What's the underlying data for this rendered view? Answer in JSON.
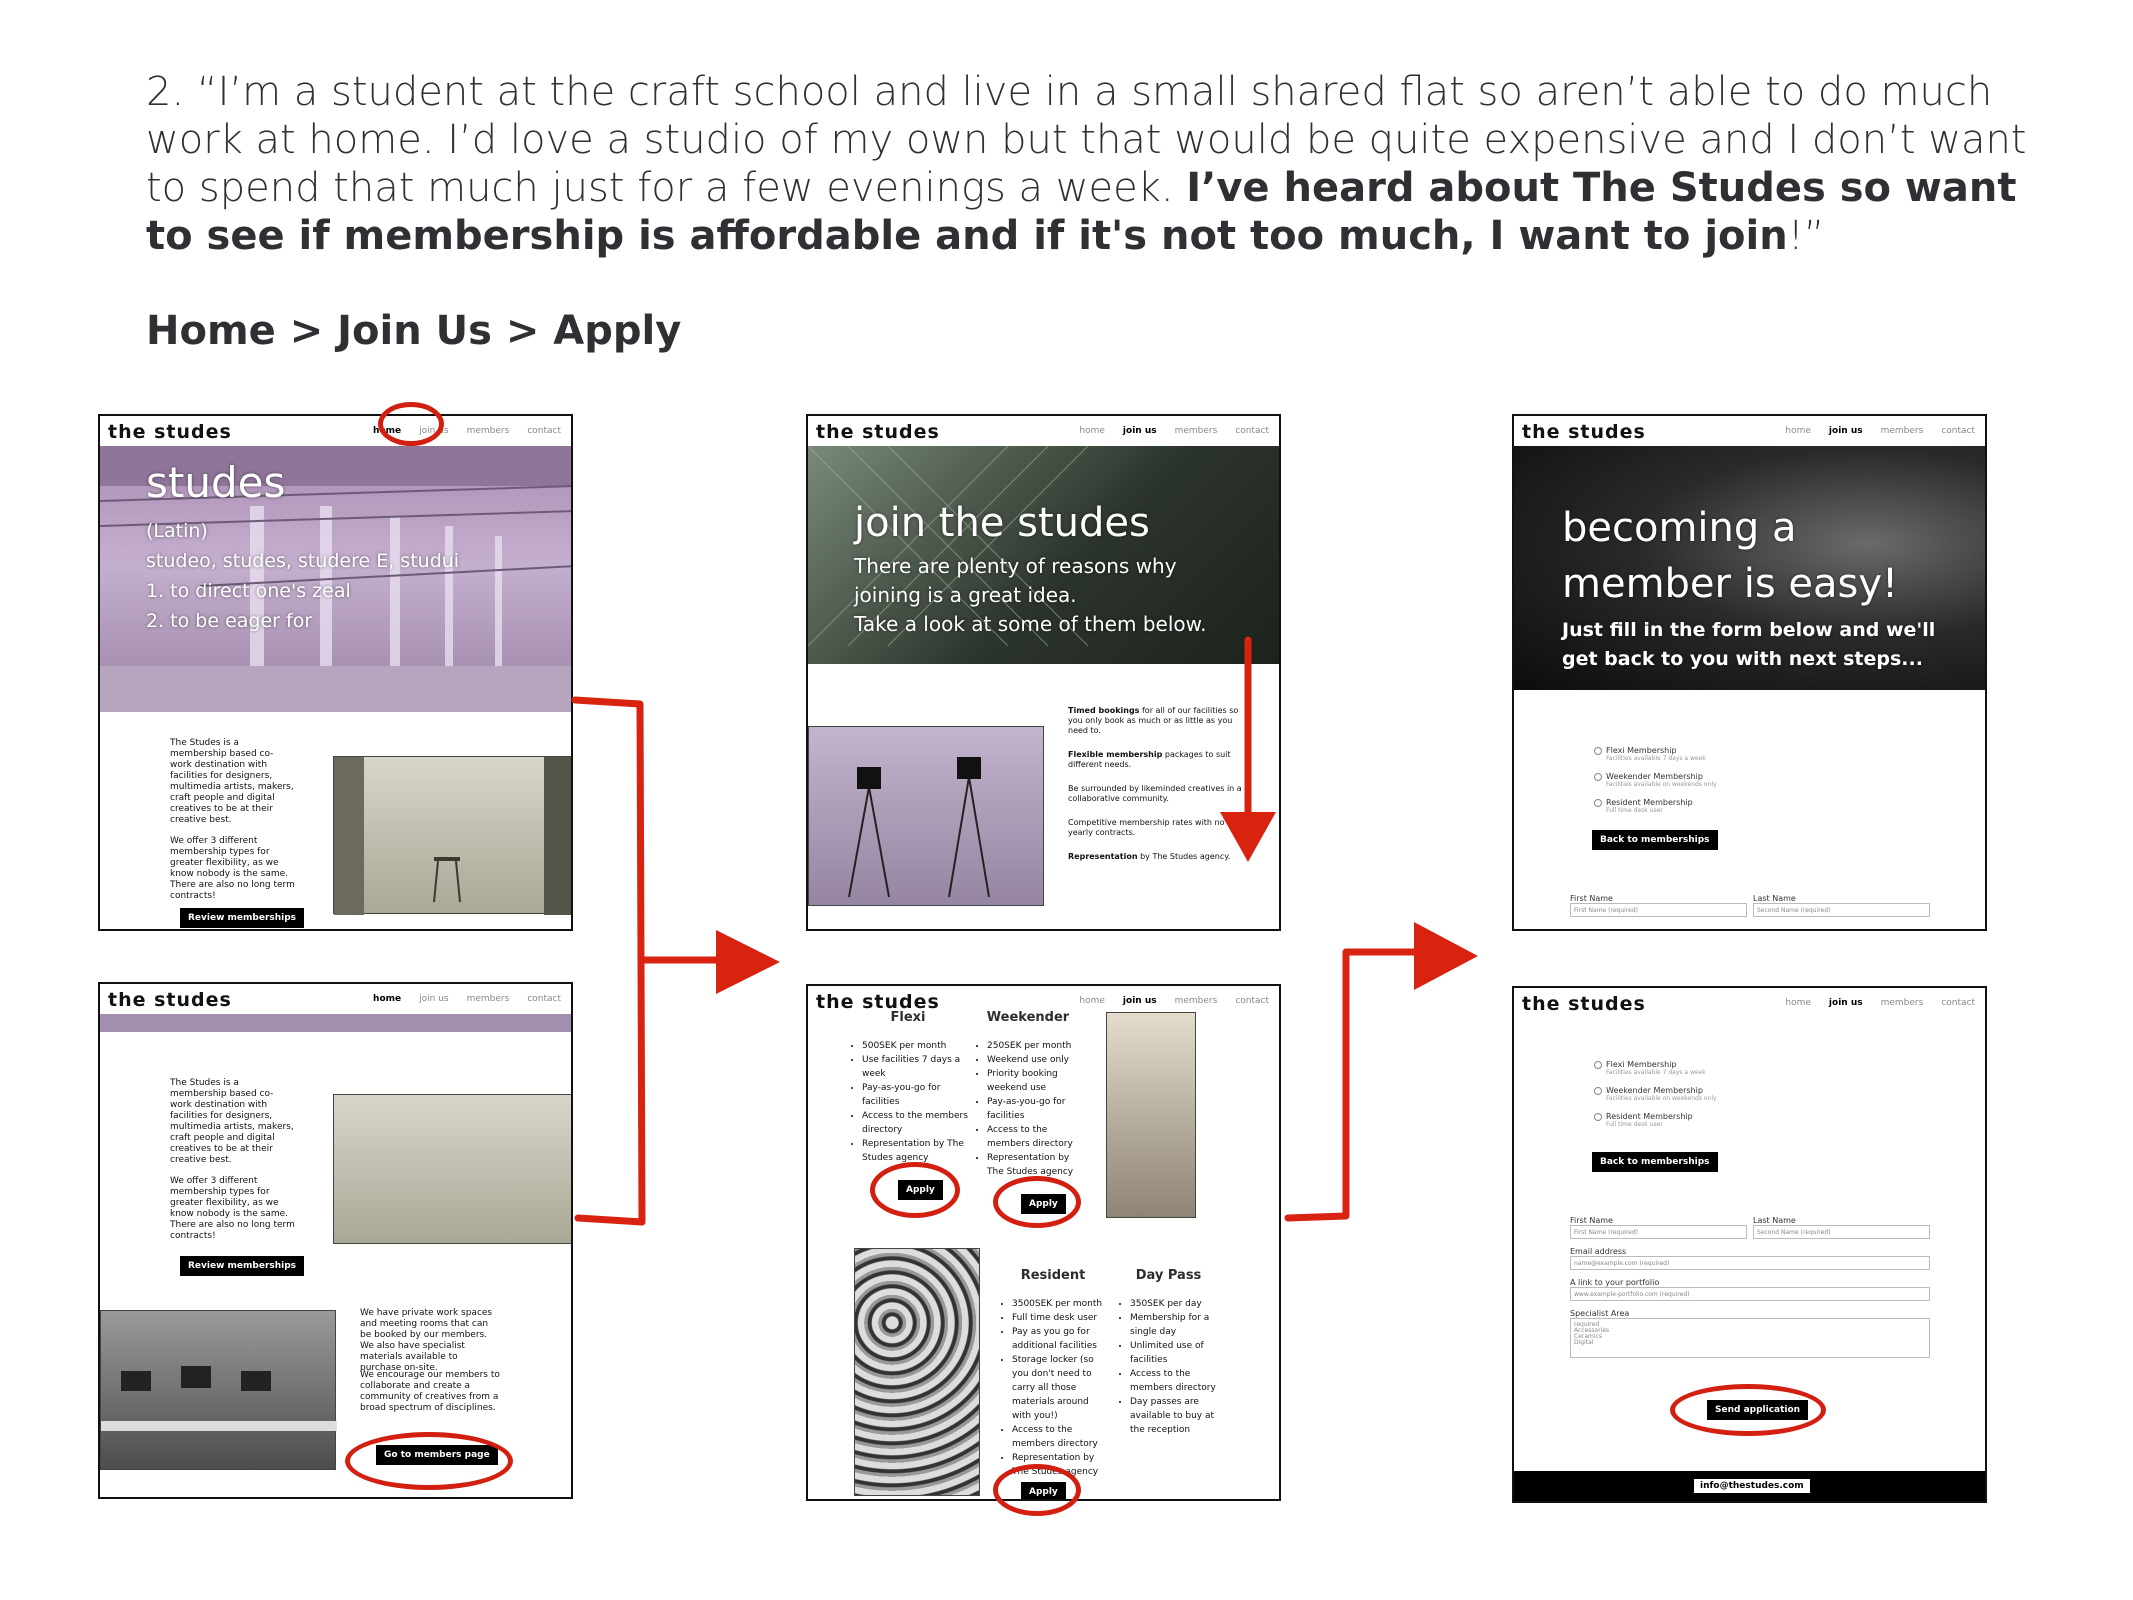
{
  "quote": {
    "lead": "2. “I’m a student at the craft school and live in a small shared flat so aren’t able to do much work at home. I’d love a studio of my own but that would be quite expensive and I don’t want to spend that much just for a few evenings a week. ",
    "bold": "I’ve heard about The Studes so want to see if membership is affordable and if it's not too much, I want to join",
    "end": "!”"
  },
  "breadcrumb": "Home > Join Us > Apply",
  "site": {
    "logo": "the studes",
    "nav": [
      "home",
      "join us",
      "members",
      "contact"
    ]
  },
  "home1": {
    "hero_title": "studes",
    "hero_lines": [
      "(Latin)",
      "studeo, studes, studere E, studui",
      "1. to direct one's zeal",
      "2. to be eager for"
    ],
    "intro": "The Studes is a membership based co-work destination with facilities for designers, multimedia artists, makers, craft people and digital creatives to be at their creative best.",
    "offer": "We offer 3 different membership types for greater flexibility, as we know nobody is the same. There are also no long term contracts!",
    "button": "Review memberships"
  },
  "home2": {
    "intro": "The Studes is a membership based co-work destination with facilities for designers, multimedia artists, makers, craft people and digital creatives to be at their creative best.",
    "offer": "We offer 3 different membership types for greater flexibility, as we know nobody is the same. There are also no long term contracts!",
    "button": "Review memberships",
    "private": "We have private work spaces and meeting rooms that can be booked by our members. We also have specialist materials available to purchase on-site.",
    "encourage": "We encourage our members to collaborate and create a community of creatives from a broad spectrum of disciplines.",
    "members_button": "Go to members page"
  },
  "join1": {
    "hero_title": "join the studes",
    "hero_lines": [
      "There are plenty of reasons why",
      "joining is a great idea.",
      "Take a look at some of them below."
    ],
    "reasons": [
      {
        "bold": "Timed bookings",
        "text": " for all of our facilities so you only book as much or as little as you need to."
      },
      {
        "bold": "Flexible membership",
        "text": " packages to suit different needs."
      },
      {
        "bold": "",
        "text": "Be surrounded by likeminded creatives in a collaborative community."
      },
      {
        "bold": "",
        "text": "Competitive membership rates with no yearly contracts."
      },
      {
        "bold": "Representation",
        "text": " by The Studes agency."
      }
    ]
  },
  "join2": {
    "plans": [
      {
        "name": "Flexi",
        "items": [
          "500SEK per month",
          "Use facilities 7 days a week",
          "Pay-as-you-go for facilities",
          "Access to the members directory",
          "Representation by The Studes agency"
        ],
        "button": "Apply"
      },
      {
        "name": "Weekender",
        "items": [
          "250SEK per month",
          "Weekend use only",
          "Priority booking weekend use",
          "Pay-as-you-go for facilities",
          "Access to the members directory",
          "Representation by The Studes agency"
        ],
        "button": "Apply"
      },
      {
        "name": "Resident",
        "items": [
          "3500SEK per month",
          "Full time desk user",
          "Pay as you go for additional facilities",
          "Storage locker (so you don't need to carry all those materials around with you!)",
          "Access to the members directory",
          "Representation by The Studes agency"
        ],
        "button": "Apply"
      },
      {
        "name": "Day Pass",
        "items": [
          "350SEK per day",
          "Membership for a single day",
          "Unlimited use of facilities",
          "Access to the members directory",
          "Day passes are available to buy at the reception"
        ]
      }
    ]
  },
  "apply1": {
    "hero_title": [
      "becoming a",
      "member is easy!"
    ],
    "hero_lines": [
      "Just fill in the form below and we'll",
      "get back to you with next steps..."
    ],
    "options": [
      {
        "label": "Flexi Membership",
        "sub": "Facilities available 7 days a week"
      },
      {
        "label": "Weekender Membership",
        "sub": "Facilities available on weekends only"
      },
      {
        "label": "Resident Membership",
        "sub": "Full time desk user"
      }
    ],
    "back_button": "Back to memberships",
    "first_name": "First Name",
    "last_name": "Last Name",
    "first_ph": "First Name (required)",
    "last_ph": "Second Name (required)"
  },
  "apply2": {
    "options": [
      {
        "label": "Flexi Membership",
        "sub": "Facilities available 7 days a week"
      },
      {
        "label": "Weekender Membership",
        "sub": "Facilities available on weekends only"
      },
      {
        "label": "Resident Membership",
        "sub": "Full time desk user"
      }
    ],
    "back_button": "Back to memberships",
    "first_name": "First Name",
    "last_name": "Last Name",
    "first_ph": "First Name (required)",
    "last_ph": "Second Name (required)",
    "email": "Email address",
    "email_ph": "name@example.com (required)",
    "portfolio": "A link to your portfolio",
    "portfolio_ph": "www.example-portfolio.com (required)",
    "specialist": "Specialist Area",
    "specialist_opts": [
      "required",
      "Accessories",
      "Ceramics",
      "Digital"
    ],
    "send_button": "Send application",
    "footer_email": "info@thestudes.com"
  },
  "colors": {
    "accent_red": "#d7230f",
    "hero_purple": "#b79ac2",
    "text_dark": "#2e3033"
  }
}
